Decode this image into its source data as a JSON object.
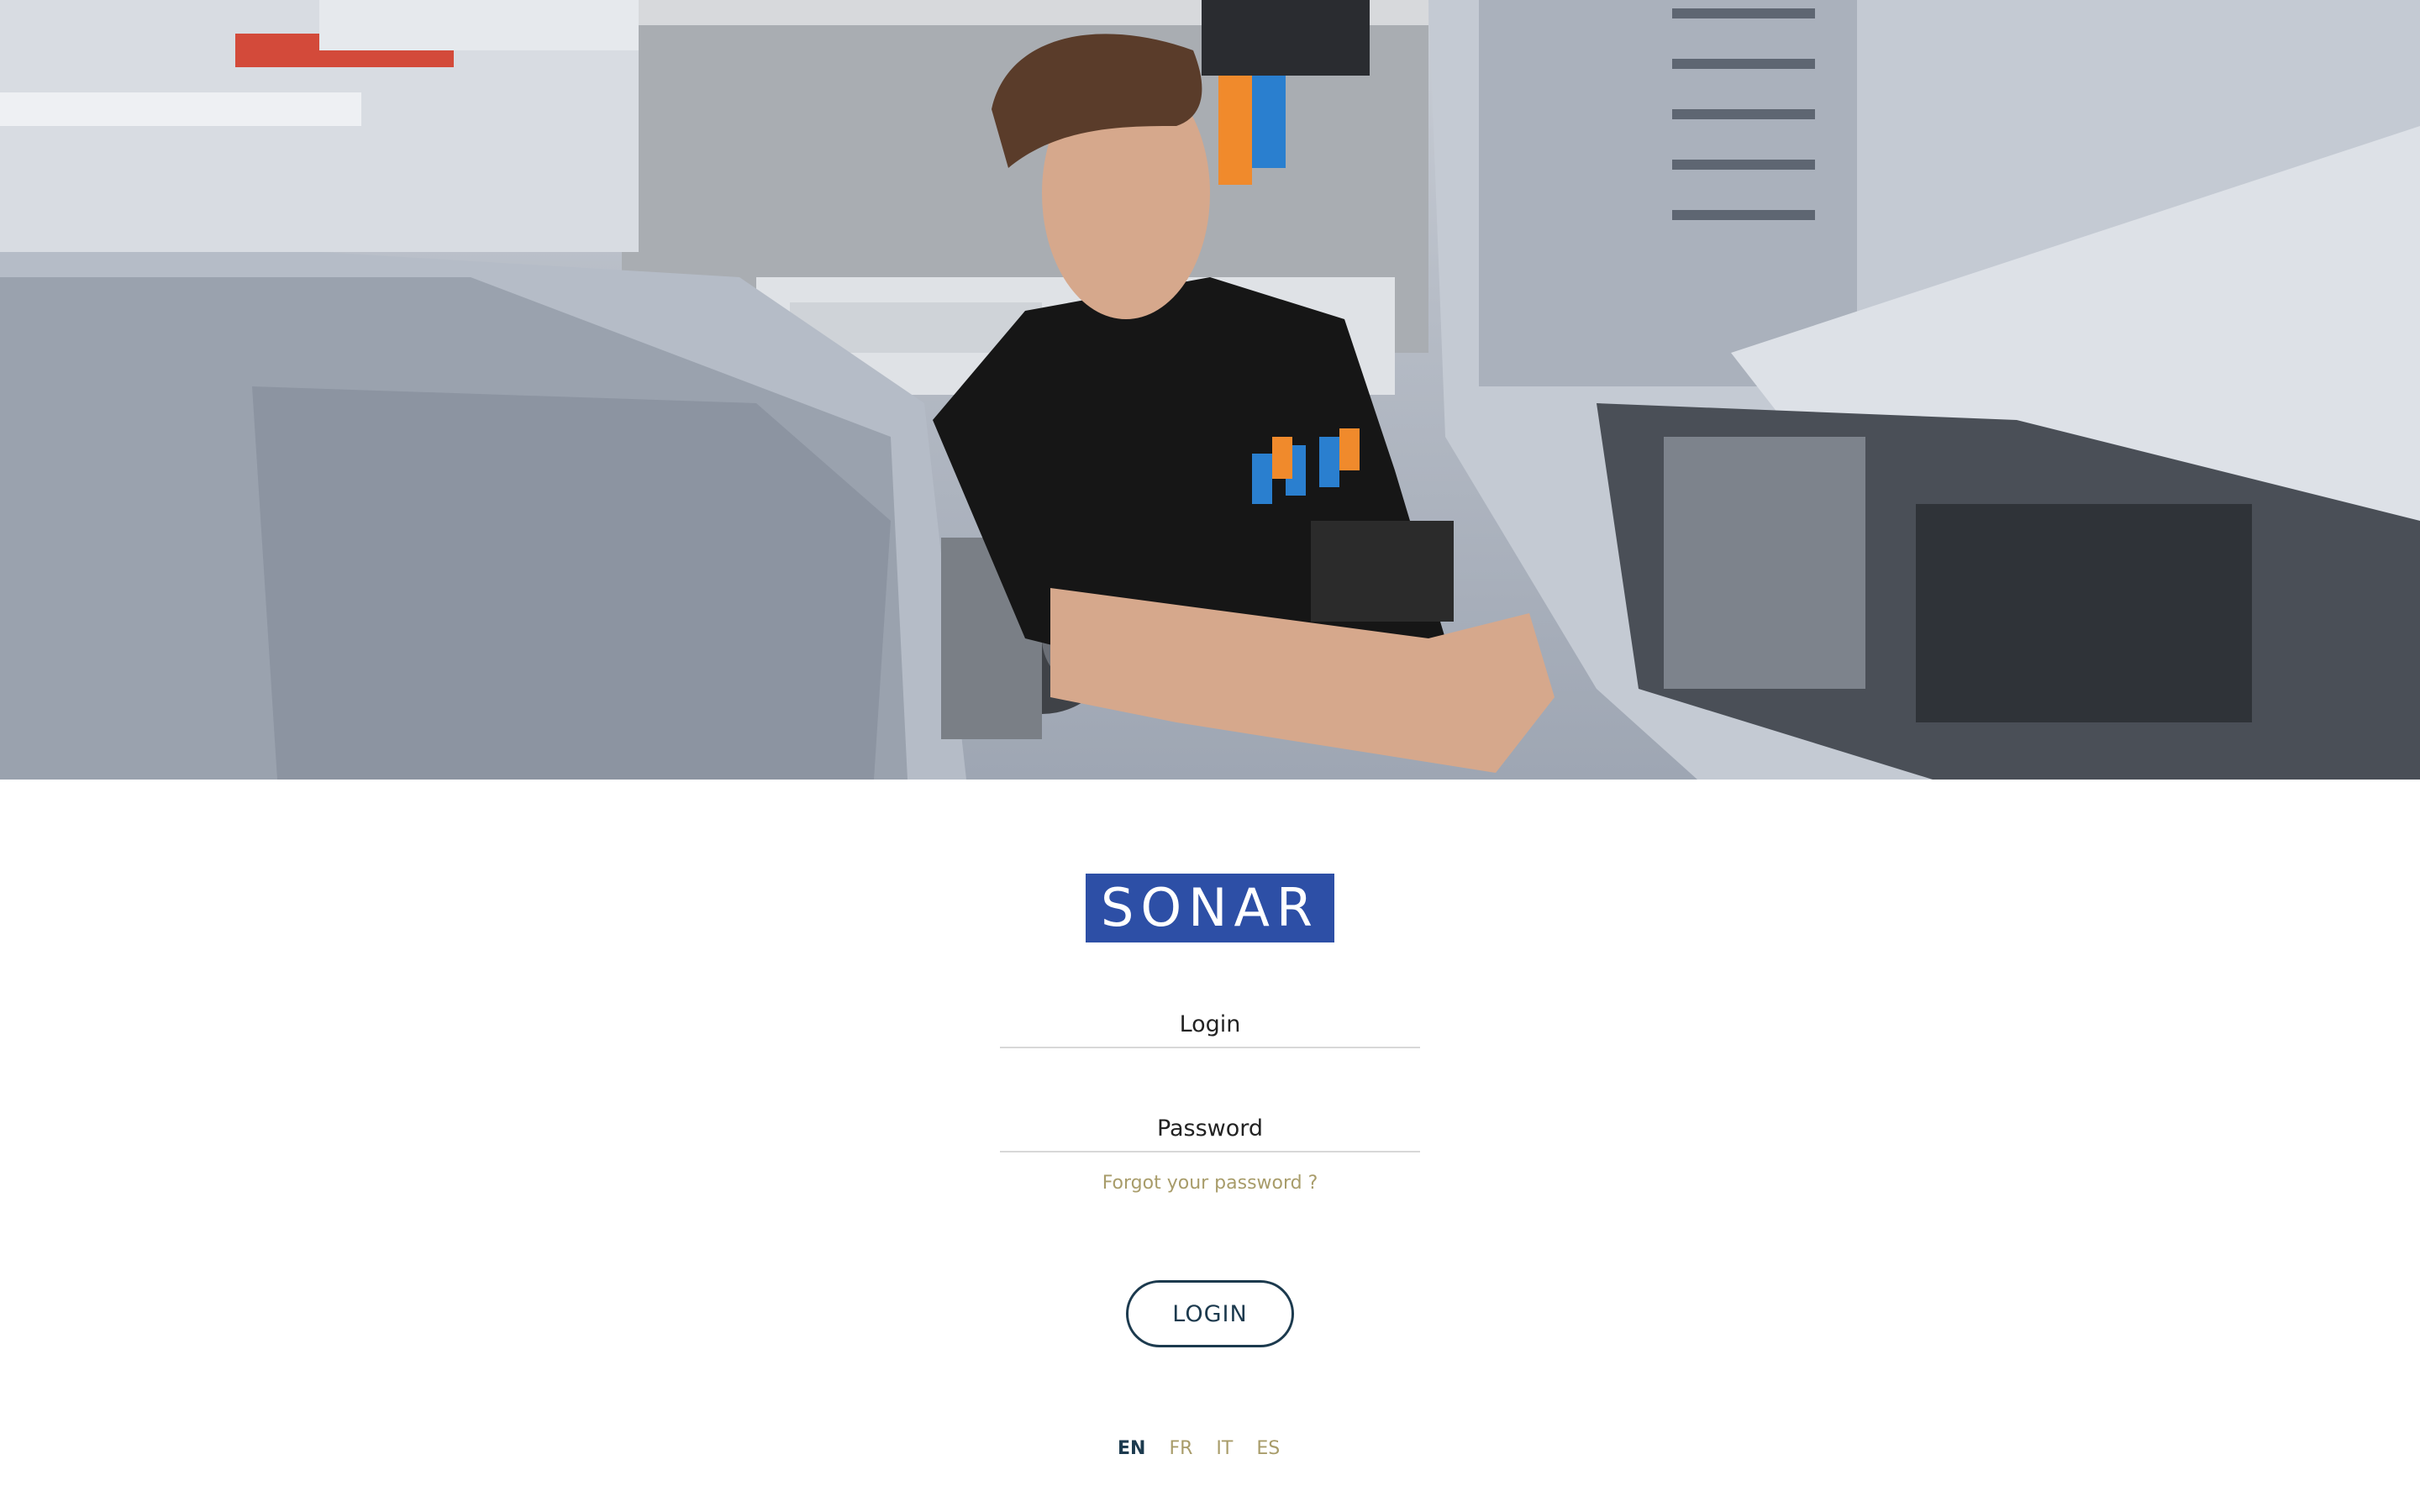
{
  "brand": {
    "name": "SONAR",
    "color": "#2d4fa6"
  },
  "form": {
    "login_placeholder": "Login",
    "password_placeholder": "Password",
    "forgot_label": "Forgot your password ?",
    "submit_label": "LOGIN"
  },
  "languages": [
    {
      "code": "EN",
      "active": true
    },
    {
      "code": "FR",
      "active": false
    },
    {
      "code": "IT",
      "active": false
    },
    {
      "code": "ES",
      "active": false
    }
  ],
  "colors": {
    "accent_gold": "#a89c6a",
    "primary_dark": "#1c3a4e"
  },
  "hero": {
    "icon": "machinist-photo"
  }
}
